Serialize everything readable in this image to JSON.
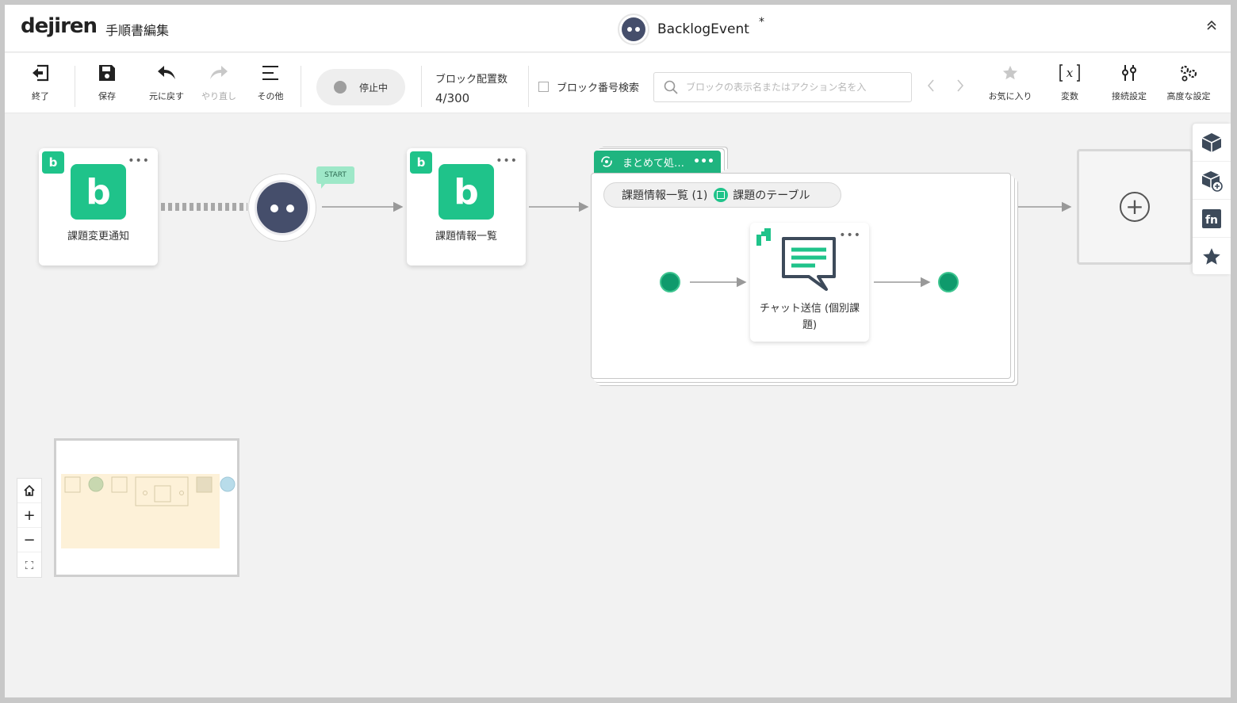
{
  "header": {
    "logo": "dejiren",
    "page_title": "手順書編集",
    "flow_name": "BacklogEvent",
    "unsaved_mark": "*"
  },
  "toolbar": {
    "exit_label": "終了",
    "save_label": "保存",
    "undo_label": "元に戻す",
    "redo_label": "やり直し",
    "other_label": "その他",
    "status_text": "停止中",
    "block_count_label": "ブロック配置数",
    "block_count_value": "4/300",
    "block_number_search_label": "ブロック番号検索",
    "search_placeholder": "ブロックの表示名またはアクション名を入",
    "favorites_label": "お気に入り",
    "variables_label": "変数",
    "connection_label": "接続設定",
    "advanced_label": "高度な設定"
  },
  "canvas": {
    "trigger_node_label": "課題変更通知",
    "start_label": "START",
    "list_node_label": "課題情報一覧",
    "loop_header_label": "まとめて処…",
    "loop_source": "課題情報一覧 (1)",
    "loop_table": "課題のテーブル",
    "chat_node_label": "チャット送信 (個別課題)",
    "node_badge_letter": "b"
  },
  "colors": {
    "accent_green": "#1fc38a",
    "loop_green": "#1fb47f",
    "robot_dark": "#454e6b"
  }
}
